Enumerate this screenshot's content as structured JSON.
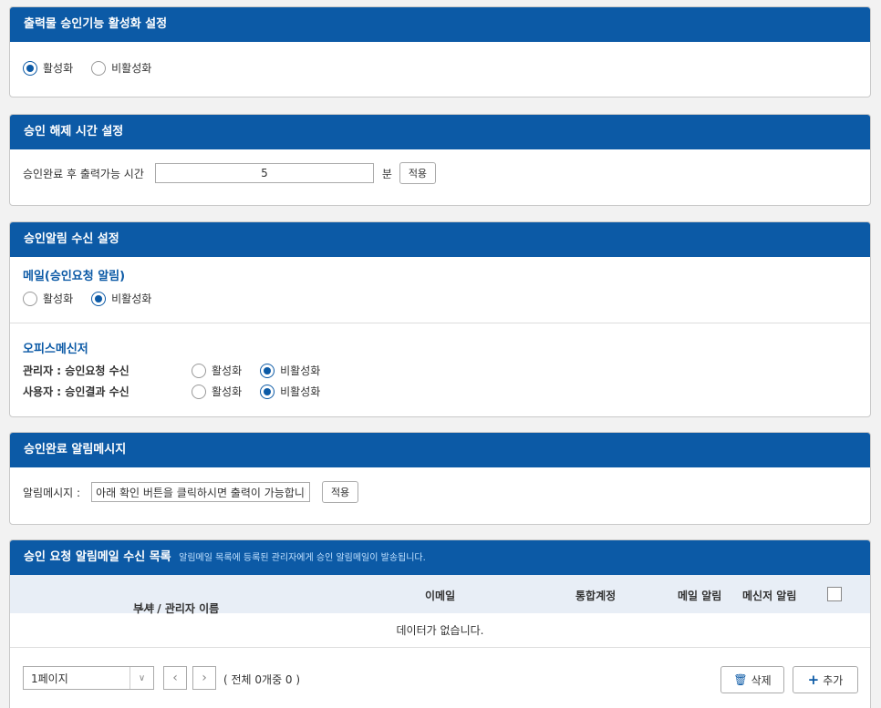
{
  "sections": {
    "output_approval": {
      "title": "출력물 승인기능 활성화 설정",
      "options": [
        "활성화",
        "비활성화"
      ],
      "selected": "활성화"
    },
    "release_time": {
      "title": "승인 해제 시간 설정",
      "label": "승인완료 후 출력가능 시간",
      "value": "5",
      "unit": "분",
      "apply_label": "적용"
    },
    "notify_receive": {
      "title": "승인알림 수신 설정",
      "mail_title": "메일(승인요청 알림)",
      "mail_options": [
        "활성화",
        "비활성화"
      ],
      "mail_selected": "비활성화",
      "messenger_title": "오피스메신저",
      "admin_label": "관리자 : 승인요청 수신",
      "admin_options": [
        "활성화",
        "비활성화"
      ],
      "admin_selected": "비활성화",
      "user_label": "사용자 : 승인결과 수신",
      "user_options": [
        "활성화",
        "비활성화"
      ],
      "user_selected": "비활성화"
    },
    "complete_message": {
      "title": "승인완료 알림메시지",
      "label": "알림메시지 :",
      "value": "아래 확인 버튼을 클릭하시면 출력이 가능합니다",
      "apply_label": "적용"
    },
    "mail_list": {
      "title": "승인 요청 알림메일 수신 목록",
      "hint": "알림메일 목록에 등록된 관리자에게 승인 알림메일이 발송됩니다.",
      "columns": [
        "부서 / 관리자 이름",
        "이메일",
        "통합계정",
        "메일 알림",
        "메신저 알림"
      ],
      "sort_icon": "↓≡",
      "empty_text": "데이터가 없습니다.",
      "page_select": "1페이지",
      "total_text": "( 전체 0개중 0 )",
      "delete_label": "삭제",
      "add_label": "추가"
    }
  },
  "colors": {
    "header_bg": "#0c5aa6",
    "accent": "#0c5aa6"
  }
}
